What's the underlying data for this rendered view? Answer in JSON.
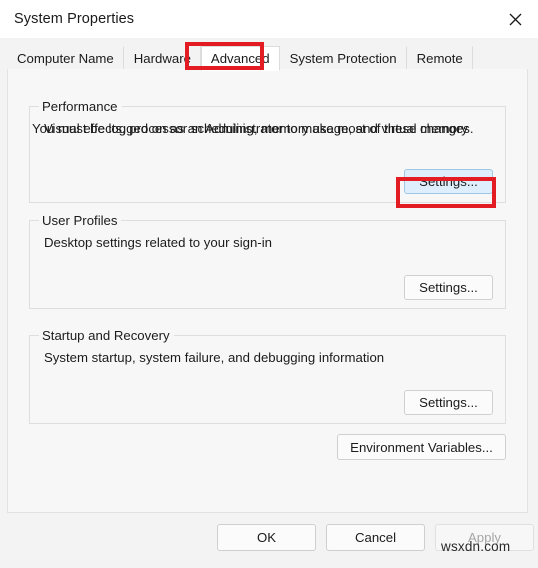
{
  "window": {
    "title": "System Properties",
    "close_icon": "close-icon"
  },
  "tabs": [
    {
      "label": "Computer Name",
      "active": false
    },
    {
      "label": "Hardware",
      "active": false
    },
    {
      "label": "Advanced",
      "active": true
    },
    {
      "label": "System Protection",
      "active": false
    },
    {
      "label": "Remote",
      "active": false
    }
  ],
  "main": {
    "admin_note": "You must be logged on as an Administrator to make most of these changes.",
    "groups": [
      {
        "legend": "Performance",
        "description": "Visual effects, processor scheduling, memory usage, and virtual memory",
        "button": "Settings..."
      },
      {
        "legend": "User Profiles",
        "description": "Desktop settings related to your sign-in",
        "button": "Settings..."
      },
      {
        "legend": "Startup and Recovery",
        "description": "System startup, system failure, and debugging information",
        "button": "Settings..."
      }
    ],
    "environment_variables_button": "Environment Variables..."
  },
  "footer": {
    "ok": "OK",
    "cancel": "Cancel",
    "apply": "Apply",
    "apply_disabled": true
  },
  "annotations": {
    "highlight_color": "#e31b23",
    "hover_color": "#dfeefc",
    "targets": [
      "Advanced",
      "Settings..."
    ]
  },
  "watermark": {
    "text": "wsxdn.com"
  }
}
